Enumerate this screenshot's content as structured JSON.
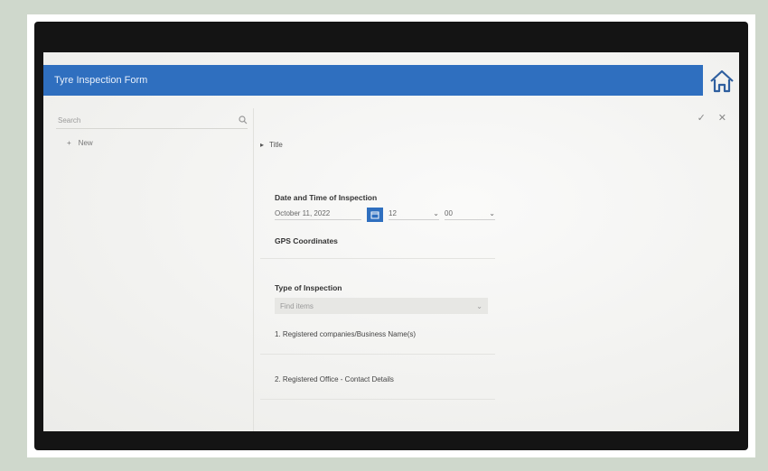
{
  "app": {
    "title": "Tyre Inspection Form"
  },
  "sidebar": {
    "search_placeholder": "Search",
    "items": [
      {
        "label": "New"
      }
    ]
  },
  "form": {
    "section_title": "Title",
    "date_label": "Date and Time of Inspection",
    "date_value": "October 11, 2022",
    "hour_value": "12",
    "minute_value": "00",
    "gps_label": "GPS Coordinates",
    "type_label": "Type of Inspection",
    "type_placeholder": "Find items",
    "sections": [
      "1. Registered companies/Business Name(s)",
      "2. Registered Office - Contact Details"
    ]
  },
  "colors": {
    "accent": "#2f6fbf"
  },
  "icons": [
    "home-icon",
    "search-icon",
    "check-icon",
    "close-icon",
    "calendar-icon",
    "chevron-down-icon"
  ]
}
